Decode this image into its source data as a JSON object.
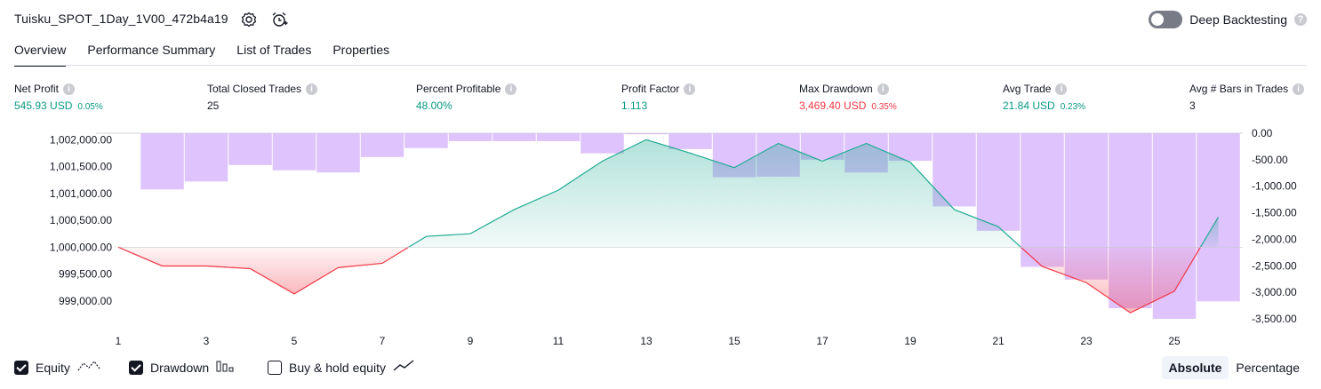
{
  "header": {
    "title": "Tuisku_SPOT_1Day_1V00_472b4a19",
    "settings_icon": "gear-icon",
    "alert_icon": "alarm-clock-plus-icon"
  },
  "deep_backtesting": {
    "label": "Deep Backtesting",
    "enabled": false,
    "help": "?"
  },
  "tabs": [
    {
      "label": "Overview",
      "active": true
    },
    {
      "label": "Performance Summary",
      "active": false
    },
    {
      "label": "List of Trades",
      "active": false
    },
    {
      "label": "Properties",
      "active": false
    }
  ],
  "metrics": {
    "net_profit": {
      "label": "Net Profit",
      "value": "545.93 USD",
      "pct": "0.05%"
    },
    "total_closed_trades": {
      "label": "Total Closed Trades",
      "value": "25"
    },
    "percent_profitable": {
      "label": "Percent Profitable",
      "value": "48.00%"
    },
    "profit_factor": {
      "label": "Profit Factor",
      "value": "1.113"
    },
    "max_drawdown": {
      "label": "Max Drawdown",
      "value": "3,469.40 USD",
      "pct": "0.35%"
    },
    "avg_trade": {
      "label": "Avg Trade",
      "value": "21.84 USD",
      "pct": "0.23%"
    },
    "avg_bars": {
      "label": "Avg # Bars in Trades",
      "value": "3"
    }
  },
  "colors": {
    "profit": "#089981",
    "loss": "#f23645",
    "drawdown_bars": "#d9b8fb",
    "equity_line_up": "#22ab94",
    "equity_line_down": "#f23645"
  },
  "chart_data": {
    "type": "line",
    "x_ticks": [
      "1",
      "3",
      "5",
      "7",
      "9",
      "11",
      "13",
      "15",
      "17",
      "19",
      "21",
      "23",
      "25"
    ],
    "left_axis": {
      "ticks": [
        "1,002,000.00",
        "1,001,500.00",
        "1,001,000.00",
        "1,000,500.00",
        "1,000,000.00",
        "999,500.00",
        "999,000.00"
      ],
      "range": [
        998650,
        1002120
      ]
    },
    "right_axis": {
      "ticks": [
        "0.00",
        "-500.00",
        "-1,000.00",
        "-1,500.00",
        "-2,000.00",
        "-2,500.00",
        "-3,000.00",
        "-3,500.00"
      ],
      "range": [
        -3500,
        0
      ]
    },
    "baseline": 1000000,
    "series": [
      {
        "name": "Equity",
        "axis": "left",
        "x": [
          1,
          2,
          3,
          4,
          5,
          6,
          7,
          8,
          9,
          10,
          11,
          12,
          13,
          14,
          15,
          16,
          17,
          18,
          19,
          20,
          21,
          22,
          23,
          24,
          25,
          26
        ],
        "values": [
          1000000,
          999650,
          999650,
          999600,
          999130,
          999620,
          999700,
          1000200,
          1000250,
          1000700,
          1001060,
          1001600,
          1002000,
          1001750,
          1001480,
          1001930,
          1001600,
          1001930,
          1001580,
          1000700,
          1000380,
          999640,
          999340,
          998780,
          999180,
          1000560
        ]
      },
      {
        "name": "Drawdown",
        "axis": "right",
        "x": [
          2,
          3,
          4,
          5,
          6,
          7,
          8,
          9,
          10,
          11,
          12,
          13,
          14,
          15,
          16,
          17,
          18,
          19,
          20,
          21,
          22,
          23,
          24,
          25,
          26
        ],
        "values": [
          -1060,
          -910,
          -600,
          -700,
          -740,
          -450,
          -280,
          -150,
          -150,
          -150,
          -380,
          -20,
          -300,
          -830,
          -820,
          -500,
          -740,
          -520,
          -1380,
          -1840,
          -2520,
          -2760,
          -3300,
          -3500,
          -3170
        ]
      }
    ]
  },
  "legend": {
    "equity": {
      "label": "Equity",
      "checked": true
    },
    "drawdown": {
      "label": "Drawdown",
      "checked": true
    },
    "buy_hold": {
      "label": "Buy & hold equity",
      "checked": false
    }
  },
  "scale_toggle": {
    "absolute": "Absolute",
    "percentage": "Percentage",
    "active": "absolute"
  }
}
